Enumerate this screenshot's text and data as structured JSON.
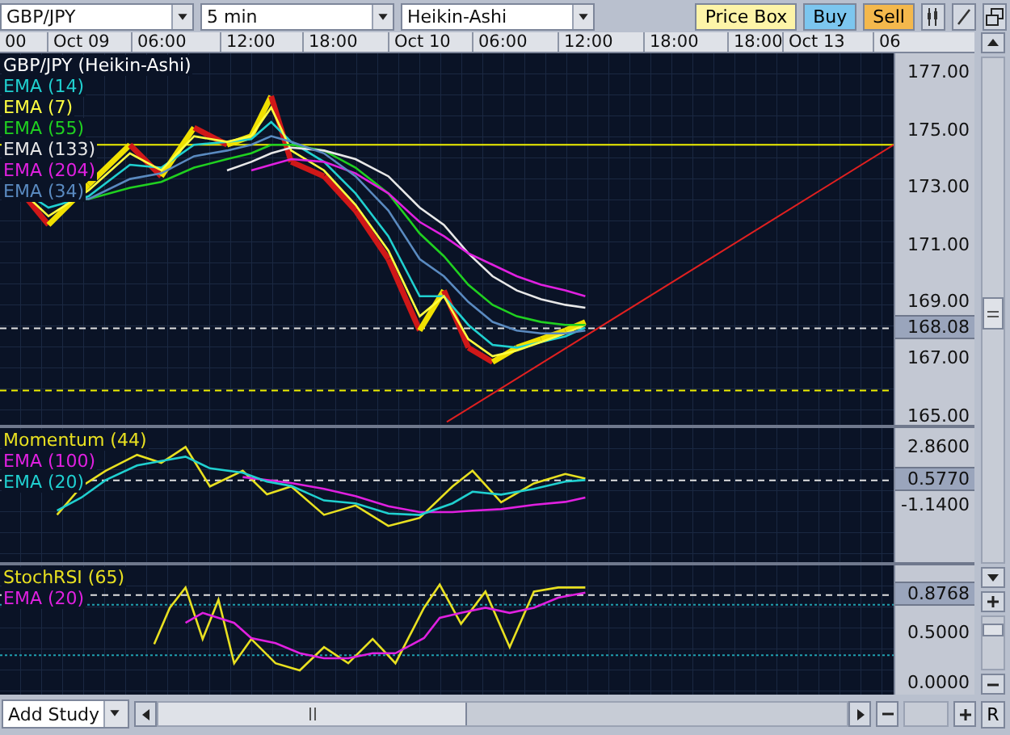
{
  "toolbar": {
    "dropdowns": [
      {
        "value": "GBP/JPY"
      },
      {
        "value": "5 min"
      },
      {
        "value": "Heikin-Ashi"
      }
    ],
    "buttons": [
      {
        "label": "Price Box",
        "kind": "price-box"
      },
      {
        "label": "Buy",
        "kind": "buy"
      },
      {
        "label": "Sell",
        "kind": "sell"
      }
    ]
  },
  "time_axis": [
    "00",
    "Oct 09",
    "06:00",
    "12:00",
    "18:00",
    "Oct 10",
    "06:00",
    "12:00",
    "18:00",
    "18:00",
    "Oct 13",
    "06"
  ],
  "panels": [
    {
      "kind": "price",
      "last_value": "168.08",
      "legend": [
        {
          "label": "GBP/JPY (Heikin-Ashi)",
          "color": "#ffffff"
        },
        {
          "label": "EMA (14)",
          "color": "#20d0d0"
        },
        {
          "label": "EMA (7)",
          "color": "#ffff40"
        },
        {
          "label": "EMA (55)",
          "color": "#20d020"
        },
        {
          "label": "EMA (133)",
          "color": "#e8e8e8"
        },
        {
          "label": "EMA (204)",
          "color": "#e020e0"
        },
        {
          "label": "EMA (34)",
          "color": "#5a8ac0"
        }
      ],
      "axis_labels": [
        "177.00",
        "175.00",
        "173.00",
        "171.00",
        "169.00",
        "167.00",
        "165.00"
      ]
    },
    {
      "kind": "indicator",
      "last_value": "0.5770",
      "legend": [
        {
          "label": "Momentum (44)",
          "color": "#e8e020"
        },
        {
          "label": "EMA (100)",
          "color": "#e020e0"
        },
        {
          "label": "EMA (20)",
          "color": "#20d0d0"
        }
      ],
      "axis_labels": [
        "2.8600",
        "-1.1400"
      ]
    },
    {
      "kind": "indicator",
      "last_value": "0.8768",
      "legend": [
        {
          "label": "StochRSI (65)",
          "color": "#e8e020"
        },
        {
          "label": "EMA (20)",
          "color": "#e020e0"
        }
      ],
      "axis_labels": [
        "0.5000",
        "0.0000"
      ]
    }
  ],
  "footer": {
    "add_study": "Add Study",
    "reset": "R"
  }
}
